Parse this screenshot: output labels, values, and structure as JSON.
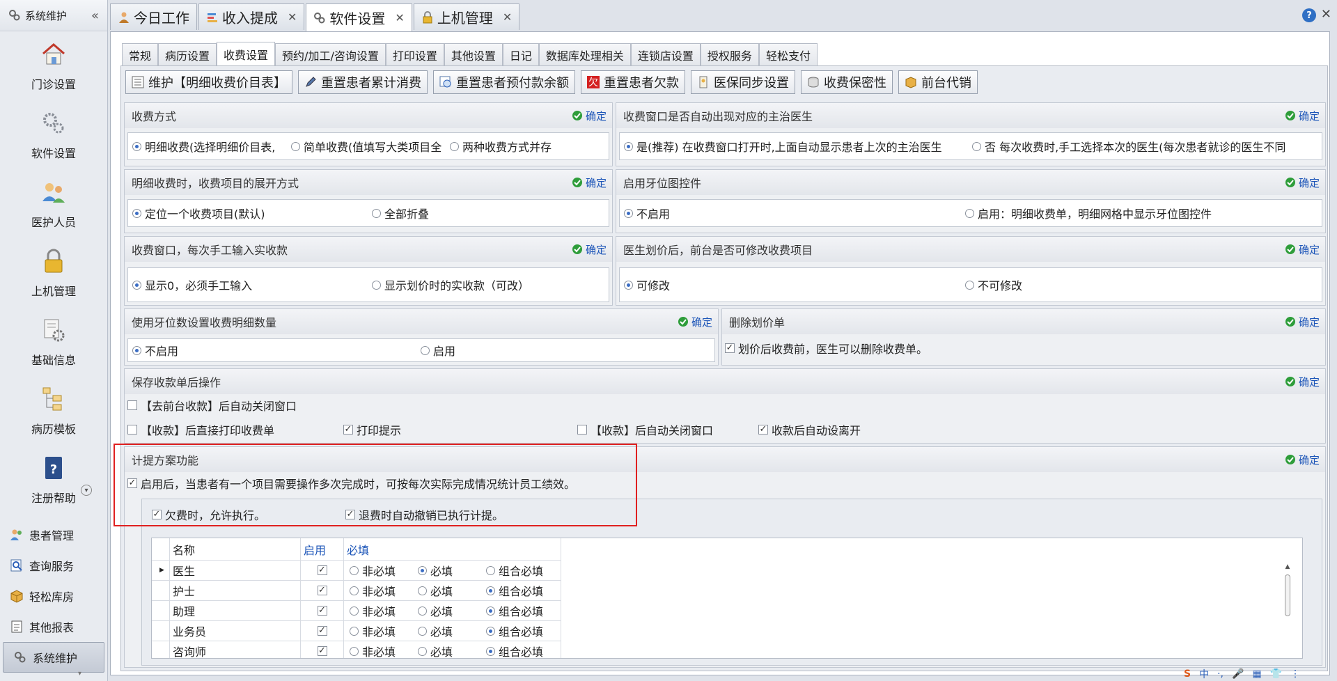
{
  "sidebar": {
    "header_title": "系统维护",
    "collapse_glyph": "«",
    "big_items": [
      {
        "label": "门诊设置",
        "icon": "house-icon"
      },
      {
        "label": "软件设置",
        "icon": "gears-icon"
      },
      {
        "label": "医护人员",
        "icon": "staff-icon"
      },
      {
        "label": "上机管理",
        "icon": "lock-icon"
      },
      {
        "label": "基础信息",
        "icon": "info-gear-icon"
      },
      {
        "label": "病历模板",
        "icon": "tree-icon"
      },
      {
        "label": "注册帮助",
        "icon": "help-book-icon"
      }
    ],
    "small_items": [
      {
        "label": "患者管理",
        "icon": "patients-icon"
      },
      {
        "label": "查询服务",
        "icon": "query-icon"
      },
      {
        "label": "轻松库房",
        "icon": "box-icon"
      },
      {
        "label": "其他报表",
        "icon": "report-icon"
      },
      {
        "label": "系统维护",
        "icon": "gears-icon",
        "active": true
      }
    ]
  },
  "top_tabs": [
    {
      "label": "今日工作",
      "closable": false
    },
    {
      "label": "收入提成",
      "closable": true
    },
    {
      "label": "软件设置",
      "closable": true,
      "active": true
    },
    {
      "label": "上机管理",
      "closable": true
    }
  ],
  "sub_tabs": [
    "常规",
    "病历设置",
    "收费设置",
    "预约/加工/咨询设置",
    "打印设置",
    "其他设置",
    "日记",
    "数据库处理相关",
    "连锁店设置",
    "授权服务",
    "轻松支付"
  ],
  "active_sub_tab": "收费设置",
  "toolbar": [
    {
      "label": "维护【明细收费价目表】",
      "icon": "list-icon"
    },
    {
      "label": "重置患者累计消费",
      "icon": "edit-icon"
    },
    {
      "label": "重置患者预付款余额",
      "icon": "reset-icon"
    },
    {
      "label": "重置患者欠款",
      "icon": "debt-icon",
      "glyph": "欠"
    },
    {
      "label": "医保同步设置",
      "icon": "sync-icon"
    },
    {
      "label": "收费保密性",
      "icon": "privacy-icon"
    },
    {
      "label": "前台代销",
      "icon": "box-icon"
    }
  ],
  "confirm_label": "确定",
  "groups": {
    "pay_mode": {
      "title": "收费方式",
      "options": [
        "明细收费(选择明细价目表,",
        "简单收费(值填写大类项目全",
        "两种收费方式并存"
      ]
    },
    "auto_doctor": {
      "title": "收费窗口是否自动出现对应的主治医生",
      "options": [
        "是(推荐)   在收费窗口打开时,上面自动显示患者上次的主治医生",
        "否     每次收费时,手工选择本次的医生(每次患者就诊的医生不同"
      ]
    },
    "expand_mode": {
      "title": "明细收费时，收费项目的展开方式",
      "options": [
        "定位一个收费项目(默认)",
        "全部折叠"
      ]
    },
    "tooth_ctrl": {
      "title": "启用牙位图控件",
      "options": [
        "不启用",
        "启用：明细收费单，明细网格中显示牙位图控件"
      ]
    },
    "manual_pay": {
      "title": "收费窗口，每次手工输入实收款",
      "options": [
        "显示0，必须手工输入",
        "显示划价时的实收款（可改）"
      ]
    },
    "doctor_price": {
      "title": "医生划价后，前台是否可修改收费项目",
      "options": [
        "可修改",
        "不可修改"
      ]
    },
    "tooth_count": {
      "title": "使用牙位数设置收费明细数量",
      "options": [
        "不启用",
        "启用"
      ]
    },
    "delete_bill": {
      "title": "删除划价单",
      "check": "划价后收费前，医生可以删除收费单。"
    },
    "after_save": {
      "title": "保存收款单后操作",
      "row1": "【去前台收款】后自动关闭窗口",
      "row2": [
        "【收款】后直接打印收费单",
        "打印提示",
        "【收款】后自动关闭窗口",
        "收款后自动设离开"
      ]
    },
    "commission": {
      "title": "计提方案功能",
      "main_check": "启用后，当患者有一个项目需要操作多次完成时，可按每次实际完成情况统计员工绩效。",
      "sub_checks": [
        "欠费时，允许执行。",
        "退费时自动撤销已执行计提。"
      ]
    }
  },
  "grid": {
    "headers": [
      "名称",
      "启用",
      "必填"
    ],
    "choices": [
      "非必填",
      "必填",
      "组合必填"
    ],
    "rows": [
      {
        "name": "医生",
        "selected": 1
      },
      {
        "name": "护士",
        "selected": 2
      },
      {
        "name": "助理",
        "selected": 2
      },
      {
        "name": "业务员",
        "selected": 2
      },
      {
        "name": "咨询师",
        "selected": 2
      }
    ]
  },
  "window": {
    "help_glyph": "?",
    "close_glyph": "✕"
  },
  "ime": {
    "items": [
      "S",
      "中",
      "·,",
      "🎤",
      "▦",
      "👕",
      "⋮"
    ]
  },
  "colors": {
    "accent": "#1c55b8",
    "highlight_box": "#e02020",
    "confirm_icon": "#2e9d3a"
  }
}
